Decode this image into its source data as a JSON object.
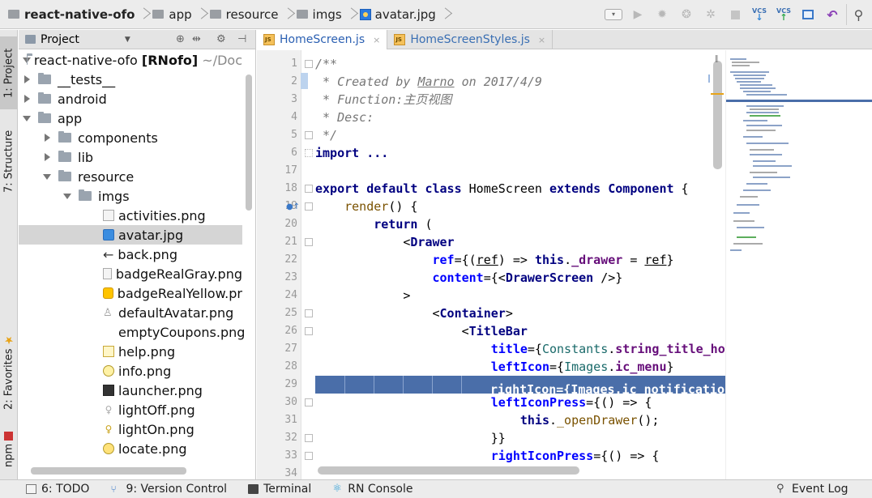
{
  "nav": {
    "crumbs": [
      "react-native-ofo",
      "app",
      "resource",
      "imgs",
      "avatar.jpg"
    ]
  },
  "toolbar": {
    "vcs_update": "VCS",
    "vcs_commit": "VCS"
  },
  "left_strip": {
    "project_tab": "1: Project",
    "structure_tab": "7: Structure",
    "favorites_tab": "2: Favorites",
    "npm_tab": "npm"
  },
  "project_panel": {
    "title": "Project",
    "root_name": "react-native-ofo",
    "root_module": "[RNofo]",
    "root_path": "~/Doc",
    "items": [
      {
        "label": "__tests__"
      },
      {
        "label": "android"
      },
      {
        "label": "app"
      },
      {
        "label": "components"
      },
      {
        "label": "lib"
      },
      {
        "label": "resource"
      },
      {
        "label": "imgs"
      },
      {
        "label": "activities.png"
      },
      {
        "label": "avatar.jpg"
      },
      {
        "label": "back.png"
      },
      {
        "label": "badgeRealGray.png"
      },
      {
        "label": "badgeRealYellow.pr"
      },
      {
        "label": "defaultAvatar.png"
      },
      {
        "label": "emptyCoupons.png"
      },
      {
        "label": "help.png"
      },
      {
        "label": "info.png"
      },
      {
        "label": "launcher.png"
      },
      {
        "label": "lightOff.png"
      },
      {
        "label": "lightOn.png"
      },
      {
        "label": "locate.png"
      }
    ]
  },
  "editor": {
    "tabs": [
      {
        "label": "HomeScreen.js"
      },
      {
        "label": "HomeScreenStyles.js"
      }
    ],
    "line_numbers": [
      "1",
      "2",
      "3",
      "4",
      "5",
      "6",
      "17",
      "18",
      "19",
      "20",
      "21",
      "22",
      "23",
      "24",
      "25",
      "26",
      "27",
      "28",
      "29",
      "30",
      "31",
      "32",
      "33",
      "34"
    ]
  },
  "bottom_bar": {
    "todo": "6: TODO",
    "version_control": "9: Version Control",
    "terminal": "Terminal",
    "rn_console": "RN Console",
    "event_log": "Event Log"
  },
  "colors": {
    "selection": "#4a6ea9",
    "keyword": "#000080",
    "attribute": "#0000ff"
  }
}
